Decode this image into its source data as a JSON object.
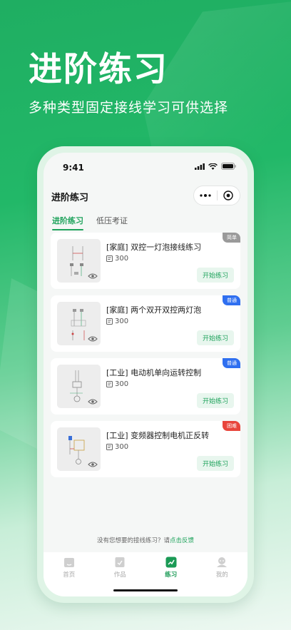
{
  "hero": {
    "title": "进阶练习",
    "subtitle": "多种类型固定接线学习可供选择"
  },
  "status_bar": {
    "time": "9:41"
  },
  "nav": {
    "title": "进阶练习",
    "more_icon": "more-dots-icon",
    "close_icon": "target-circle-icon"
  },
  "tabs": [
    {
      "label": "进阶练习",
      "active": true
    },
    {
      "label": "低压考证",
      "active": false
    }
  ],
  "exercises": [
    {
      "title": "[家庭] 双控一灯泡接线练习",
      "count": "300",
      "badge": "简单",
      "badge_color": "#9a9a9a",
      "button": "开始练习"
    },
    {
      "title": "[家庭] 两个双开双控两灯泡",
      "count": "300",
      "badge": "普通",
      "badge_color": "#2f6ff0",
      "button": "开始练习"
    },
    {
      "title": "[工业] 电动机单向运转控制",
      "count": "300",
      "badge": "普通",
      "badge_color": "#2f6ff0",
      "button": "开始练习"
    },
    {
      "title": "[工业] 变频器控制电机正反转",
      "count": "300",
      "badge": "困难",
      "badge_color": "#e8453c",
      "button": "开始练习"
    }
  ],
  "feedback": {
    "text": "没有您想要的接线练习？请",
    "link": "点击反馈"
  },
  "tabbar": [
    {
      "label": "首页",
      "icon": "home-icon",
      "active": false
    },
    {
      "label": "作品",
      "icon": "works-icon",
      "active": false
    },
    {
      "label": "练习",
      "icon": "practice-icon",
      "active": true
    },
    {
      "label": "我的",
      "icon": "profile-icon",
      "active": false
    }
  ],
  "colors": {
    "accent": "#1fa35c",
    "background_gradient_top": "#1fae62"
  }
}
